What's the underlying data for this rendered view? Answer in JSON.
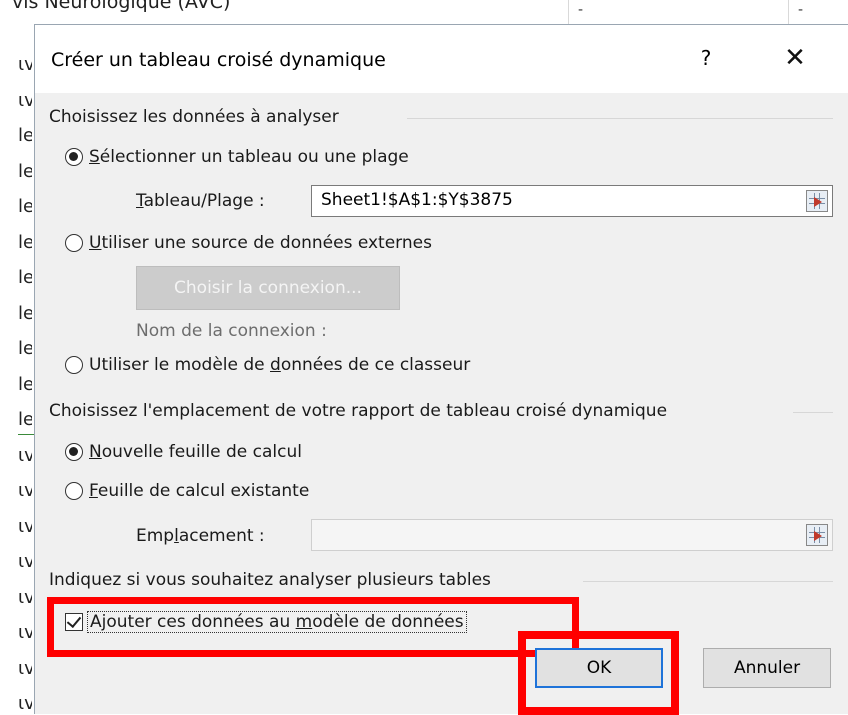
{
  "background": {
    "sheet_text": "vis Neurologique (AVC)",
    "cell_marks": [
      "-",
      "-"
    ],
    "row_glyphs": [
      "ɩv",
      "ɩv",
      "le",
      "le",
      "le",
      "le",
      "le",
      "le",
      "le",
      "le",
      "le",
      "ɩv",
      "ɩv",
      "ɩv",
      "ɩv",
      "ɩv",
      "ɩv",
      "ɩv",
      "ɩv"
    ]
  },
  "dialog": {
    "title": "Créer un tableau croisé dynamique",
    "help_label": "?",
    "close_label": "✕",
    "section_data": {
      "title": "Choisissez les données à analyser",
      "option_select": "Sélectionner un tableau ou une plage",
      "range_label": "Tableau/Plage :",
      "range_value": "Sheet1!$A$1:$Y$3875",
      "option_external": "Utiliser une source de données externes",
      "choose_connection": "Choisir la connexion...",
      "connection_name_label": "Nom de la connexion :",
      "option_model": "Utiliser le modèle de données de ce classeur",
      "selected": "option_select"
    },
    "section_location": {
      "title": "Choisissez l'emplacement de votre rapport de tableau croisé dynamique",
      "option_new_sheet": "Nouvelle feuille de calcul",
      "option_existing_sheet": "Feuille de calcul existante",
      "location_label": "Emplacement :",
      "location_value": "",
      "selected": "option_new_sheet"
    },
    "section_multi": {
      "title": "Indiquez si vous souhaitez analyser plusieurs tables",
      "add_to_model": "Ajouter ces données au modèle de données",
      "add_to_model_checked": true
    },
    "buttons": {
      "ok": "OK",
      "cancel": "Annuler"
    }
  },
  "colors": {
    "highlight": "#ff0000",
    "dialog_bg": "#f0f0f0",
    "ok_border": "#1e73d9"
  }
}
